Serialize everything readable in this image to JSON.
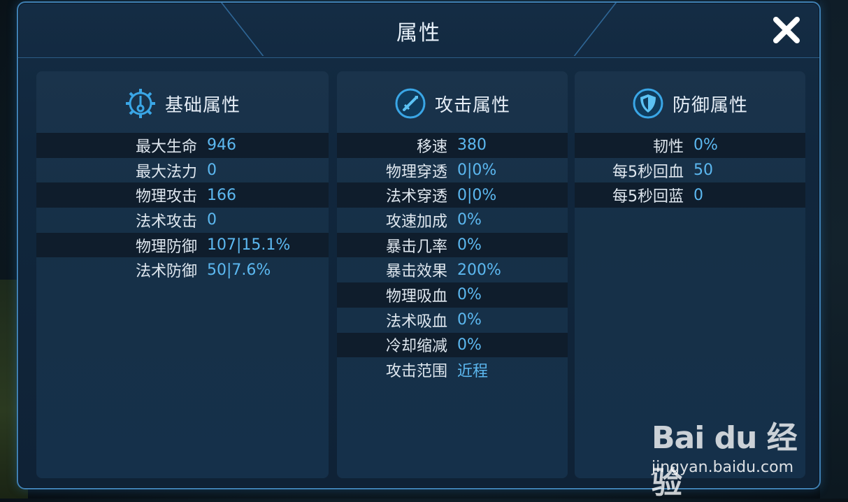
{
  "dialog": {
    "title": "属性"
  },
  "panels": [
    {
      "title": "基础属性",
      "icon": "gear-crosshair-icon",
      "rows": [
        {
          "label": "最大生命",
          "value": "946"
        },
        {
          "label": "最大法力",
          "value": "0"
        },
        {
          "label": "物理攻击",
          "value": "166"
        },
        {
          "label": "法术攻击",
          "value": "0"
        },
        {
          "label": "物理防御",
          "value": "107|15.1%"
        },
        {
          "label": "法术防御",
          "value": "50|7.6%"
        }
      ]
    },
    {
      "title": "攻击属性",
      "icon": "sword-icon",
      "rows": [
        {
          "label": "移速",
          "value": "380"
        },
        {
          "label": "物理穿透",
          "value": "0|0%"
        },
        {
          "label": "法术穿透",
          "value": "0|0%"
        },
        {
          "label": "攻速加成",
          "value": "0%"
        },
        {
          "label": "暴击几率",
          "value": "0%"
        },
        {
          "label": "暴击效果",
          "value": "200%"
        },
        {
          "label": "物理吸血",
          "value": "0%"
        },
        {
          "label": "法术吸血",
          "value": "0%"
        },
        {
          "label": "冷却缩减",
          "value": "0%"
        },
        {
          "label": "攻击范围",
          "value": "近程"
        }
      ]
    },
    {
      "title": "防御属性",
      "icon": "shield-icon",
      "rows": [
        {
          "label": "韧性",
          "value": "0%"
        },
        {
          "label": "每5秒回血",
          "value": "50"
        },
        {
          "label": "每5秒回蓝",
          "value": "0"
        }
      ]
    }
  ],
  "watermark": {
    "logo": "Bai du 经验",
    "url": "jingyan.baidu.com"
  },
  "colors": {
    "accent": "#5cb8f0",
    "border": "#3f7fb2",
    "panel": "#15304a"
  }
}
